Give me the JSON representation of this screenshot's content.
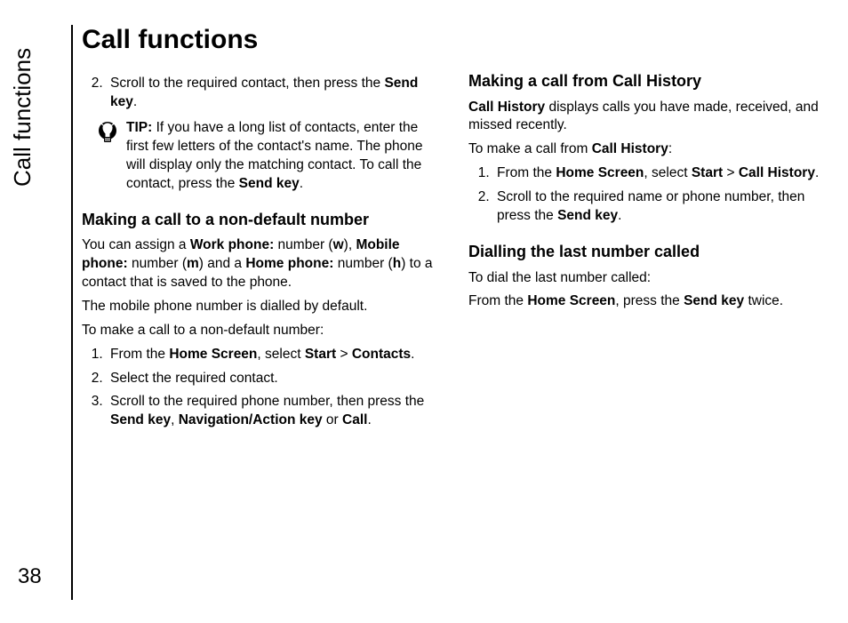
{
  "page": {
    "side_label": "Call functions",
    "page_number": "38",
    "title": "Call functions"
  },
  "left": {
    "step2_prefix": "Scroll to the required contact, then press the ",
    "step2_bold": "Send key",
    "step2_suffix": ".",
    "tip_label": "TIP:",
    "tip_prefix": " If you have a long list of contacts, enter the first few letters of the contact's name. The phone will display only the matching contact. To call the contact, press the ",
    "tip_bold": "Send key",
    "tip_suffix": ".",
    "h_nondefault": "Making a call to a non-default number",
    "nd_p1_a": "You can assign a ",
    "nd_p1_b": "Work phone:",
    "nd_p1_c": " number (",
    "nd_p1_d": "w",
    "nd_p1_e": "), ",
    "nd_p1_f": "Mobile phone:",
    "nd_p1_g": " number (",
    "nd_p1_h": "m",
    "nd_p1_i": ") and a ",
    "nd_p1_j": "Home phone:",
    "nd_p1_k": " number (",
    "nd_p1_l": "h",
    "nd_p1_m": ") to a contact that is saved to the phone.",
    "nd_p2": "The mobile phone number is dialled by default.",
    "nd_p3": "To make a call to a non-default number:",
    "nd_s1_a": "From the ",
    "nd_s1_b": "Home Screen",
    "nd_s1_c": ", select ",
    "nd_s1_d": "Start",
    "nd_s1_e": " > ",
    "nd_s1_f": "Contacts",
    "nd_s1_g": ".",
    "nd_s2": "Select the required contact.",
    "nd_s3_a": "Scroll to the required phone number, then press the ",
    "nd_s3_b": "Send key",
    "nd_s3_c": ", ",
    "nd_s3_d": "Navigation/Action key",
    "nd_s3_e": " or ",
    "nd_s3_f": "Call",
    "nd_s3_g": "."
  },
  "right": {
    "h_history": "Making a call from Call History",
    "hist_p1_a": "Call History",
    "hist_p1_b": " displays calls you have made, received, and missed recently.",
    "hist_p2_a": "To make a call from ",
    "hist_p2_b": "Call History",
    "hist_p2_c": ":",
    "hist_s1_a": "From the ",
    "hist_s1_b": "Home Screen",
    "hist_s1_c": ", select ",
    "hist_s1_d": "Start",
    "hist_s1_e": " > ",
    "hist_s1_f": "Call History",
    "hist_s1_g": ".",
    "hist_s2_a": "Scroll to the required name or phone number, then press the ",
    "hist_s2_b": "Send key",
    "hist_s2_c": ".",
    "h_last": "Dialling the last number called",
    "last_p1": "To dial the last number called:",
    "last_p2_a": "From the ",
    "last_p2_b": "Home Screen",
    "last_p2_c": ", press the ",
    "last_p2_d": "Send key",
    "last_p2_e": " twice."
  }
}
